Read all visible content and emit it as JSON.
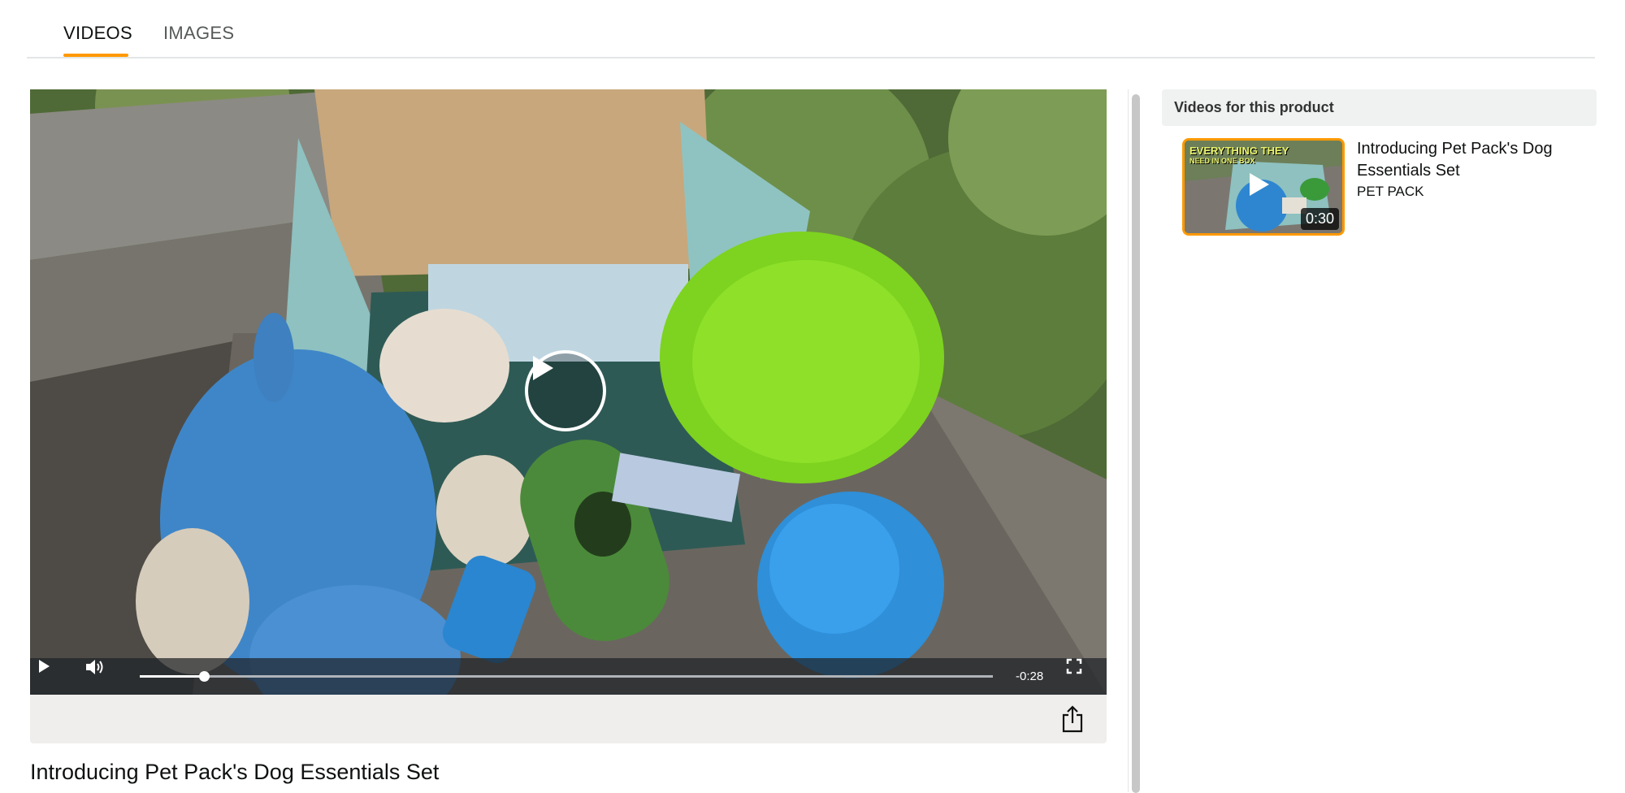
{
  "tabs": [
    {
      "label": "VIDEOS",
      "active": true
    },
    {
      "label": "IMAGES",
      "active": false
    }
  ],
  "accent_color": "#ff9900",
  "player": {
    "title": "Introducing Pet Pack's Dog Essentials Set",
    "time_remaining": "-0:28",
    "progress_fraction": 0.075,
    "icons": {
      "big_play": "play-icon",
      "play": "play-icon",
      "volume": "volume-icon",
      "fullscreen": "fullscreen-icon",
      "share": "share-icon"
    }
  },
  "sidebar": {
    "header": "Videos for this product",
    "videos": [
      {
        "title": "Introducing Pet Pack's Dog Essentials Set",
        "vendor": "PET PACK",
        "duration": "0:30",
        "thumb_caption_1": "EVERYTHING THEY",
        "thumb_caption_2": "NEED IN ONE BOX"
      }
    ]
  }
}
